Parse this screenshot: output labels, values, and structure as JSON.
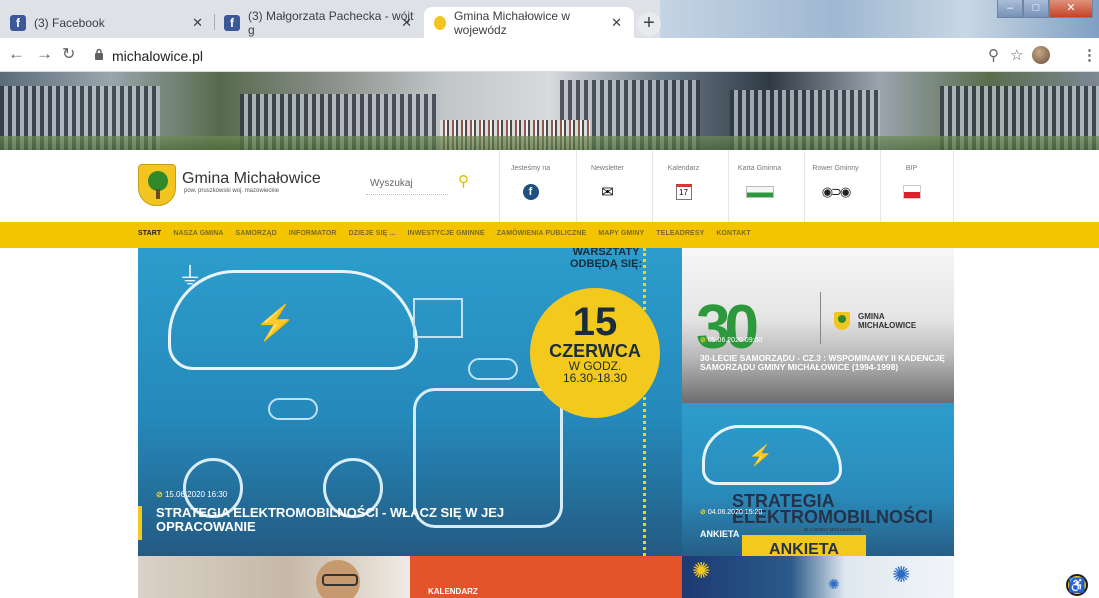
{
  "browser": {
    "tabs": [
      {
        "title": "(3) Facebook",
        "active": false
      },
      {
        "title": "(3) Małgorzata Pachecka - wójt g",
        "active": false
      },
      {
        "title": "Gmina Michałowice w wojewódz",
        "active": true
      }
    ],
    "url": "michalowice.pl"
  },
  "site": {
    "logo_title": "Gmina Michałowice",
    "logo_subtitle": "pow. pruszkowski woj. mazowieckie",
    "search_placeholder": "Wyszukaj",
    "header_links": [
      {
        "label": "Jesteśmy na",
        "icon": "facebook-icon"
      },
      {
        "label": "Newsletter",
        "icon": "envelope-icon"
      },
      {
        "label": "Kalendarz",
        "icon": "calendar-icon",
        "day": "17"
      },
      {
        "label": "Karta Gminna",
        "icon": "card-icon"
      },
      {
        "label": "Rower Gminny",
        "icon": "bike-icon"
      },
      {
        "label": "BIP",
        "icon": "bip-icon"
      }
    ],
    "menu": [
      "START",
      "NASZA GMINA",
      "SAMORZĄD",
      "INFORMATOR",
      "DZIEJE SIĘ ...",
      "INWESTYCJE GMINNE",
      "ZAMÓWIENIA PUBLICZNE",
      "MAPY GMINY",
      "TELEADRESY",
      "KONTAKT"
    ],
    "active_menu": "START"
  },
  "hero": {
    "top_text": "WARSZTATY\nODBĘDĄ SIĘ:",
    "badge_day": "15",
    "badge_month": "CZERWCA",
    "badge_time_label": "W GODZ.",
    "badge_time": "16.30-18.30",
    "date": "15.06.2020 16:30",
    "title": "STRATEGIA ELEKTROMOBILNOŚCI - WŁĄCZ SIĘ W JEJ OPRACOWANIE"
  },
  "side_news": [
    {
      "date": "05.06.2020 09:00",
      "title": "30-LECIE SAMORZĄDU - CZ.3 : WSPOMINAMY II KADENCJĘ SAMORZĄDU GMINY MICHAŁOWICE (1994-1998)",
      "logo_text": "GMINA MICHAŁOWICE",
      "big_number": "30"
    },
    {
      "date": "04.06.2020 15:20",
      "title": "ANKIETA",
      "poster_title": "STRATEGIA\nELEKTROMOBILNOŚCI",
      "poster_subtitle": "DLA GMINY MICHAŁOWICE",
      "poster_band": "ANKIETA"
    }
  ],
  "bottom_tiles": [
    {
      "label": ""
    },
    {
      "label": "KALENDARZ"
    },
    {
      "label": ""
    }
  ],
  "colors": {
    "accent": "#f2c500",
    "hero_blue": "#2c9dcc",
    "orange": "#e3542b"
  }
}
